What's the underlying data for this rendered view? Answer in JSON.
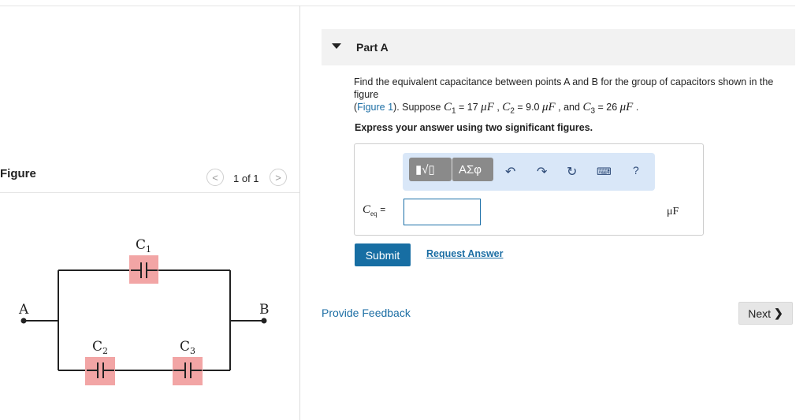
{
  "figure_panel": {
    "title": "Figure",
    "prev_glyph": "<",
    "next_glyph": ">",
    "pager": "1 of 1",
    "circuit": {
      "node_a": "A",
      "node_b": "B",
      "c1_label": "C",
      "c1_sub": "1",
      "c2_label": "C",
      "c2_sub": "2",
      "c3_label": "C",
      "c3_sub": "3",
      "capacitor_color": "#f2a5a5"
    }
  },
  "part": {
    "label": "Part A"
  },
  "question": {
    "line1": "Find the equivalent capacitance between points A and B for the group of capacitors shown in the figure",
    "figure_link": "Figure 1",
    "suppose": "). Suppose ",
    "c1_sym": "C",
    "c1_sub": "1",
    "c1_val": " = 17 ",
    "c2_sym": "C",
    "c2_sub": "2",
    "c2_val": " = 9.0 ",
    "c3_sym": "C",
    "c3_sub": "3",
    "c3_val": " = 26 ",
    "unit": "μF",
    "sep1": " , ",
    "sep2": " , and ",
    "end": " .",
    "open_paren": "("
  },
  "instruction": "Express your answer using two significant figures.",
  "answer": {
    "var_symbol": "C",
    "var_sub": "eq",
    "equals": "=",
    "value": "",
    "unit": "μF"
  },
  "toolbar": {
    "template_glyph": "▮√▯",
    "symbols_glyph": "ΑΣφ",
    "undo_icon": "undo-icon",
    "redo_icon": "redo-icon",
    "reset_icon": "reset-icon",
    "keyboard_icon": "keyboard-icon",
    "help": "?"
  },
  "buttons": {
    "submit": "Submit",
    "request_answer": "Request Answer",
    "provide_feedback": "Provide Feedback",
    "next": "Next"
  },
  "colors": {
    "accent": "#176ea3",
    "link": "#1c6ea4",
    "toolbar_bg": "#d9e7f8"
  }
}
